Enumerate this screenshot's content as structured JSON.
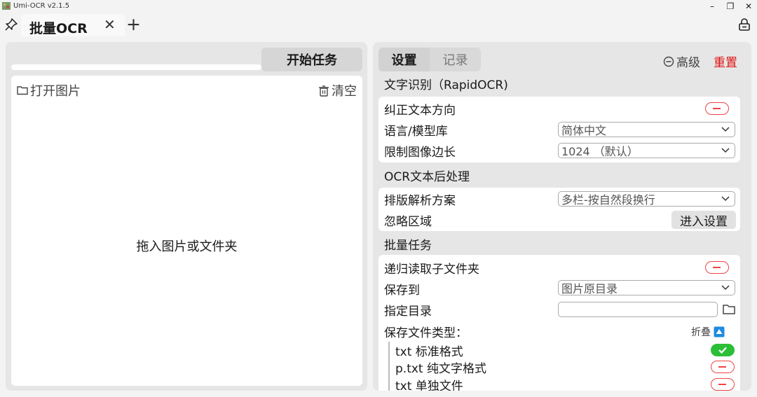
{
  "window": {
    "title": "Umi-OCR v2.1.5",
    "minimize": "–",
    "maximize": "❐",
    "close": "✕",
    "icons": {
      "app": "app-icon",
      "pin": "pin-icon",
      "lock": "lock-icon"
    }
  },
  "tabbar": {
    "tab_title": "批量OCR",
    "tab_close": "✕",
    "add": "+"
  },
  "left": {
    "start_button": "开始任务",
    "open_image": "打开图片",
    "clear": "清空",
    "drop_hint": "拖入图片或文件夹",
    "progress": 0
  },
  "right": {
    "tabs": [
      "设置",
      "记录"
    ],
    "advanced": "高级",
    "reset": "重置",
    "reset_color": "#e01010",
    "sections": {
      "ocr": {
        "title": "文字识别（RapidOCR)",
        "correct_direction": "纠正文本方向",
        "correct_direction_on": false,
        "language_label": "语言/模型库",
        "language_value": "简体中文",
        "limit_label": "限制图像边长",
        "limit_value": "1024 （默认）"
      },
      "post": {
        "title": "OCR文本后处理",
        "layout_label": "排版解析方案",
        "layout_value": "多栏-按自然段换行",
        "ignore_label": "忽略区域",
        "ignore_button": "进入设置"
      },
      "batch": {
        "title": "批量任务",
        "recursive_label": "递归读取子文件夹",
        "recursive_on": false,
        "save_to_label": "保存到",
        "save_to_value": "图片原目录",
        "dir_label": "指定目录",
        "dir_value": "",
        "file_types_label": "保存文件类型：",
        "collapse": "折叠",
        "types": [
          {
            "label": "txt 标准格式",
            "on": true
          },
          {
            "label": "p.txt 纯文字格式",
            "on": false
          },
          {
            "label": "txt 单独文件",
            "on": false
          }
        ]
      }
    },
    "toggle_on_color": "#2bbf38",
    "toggle_off_color": "#e44444"
  }
}
